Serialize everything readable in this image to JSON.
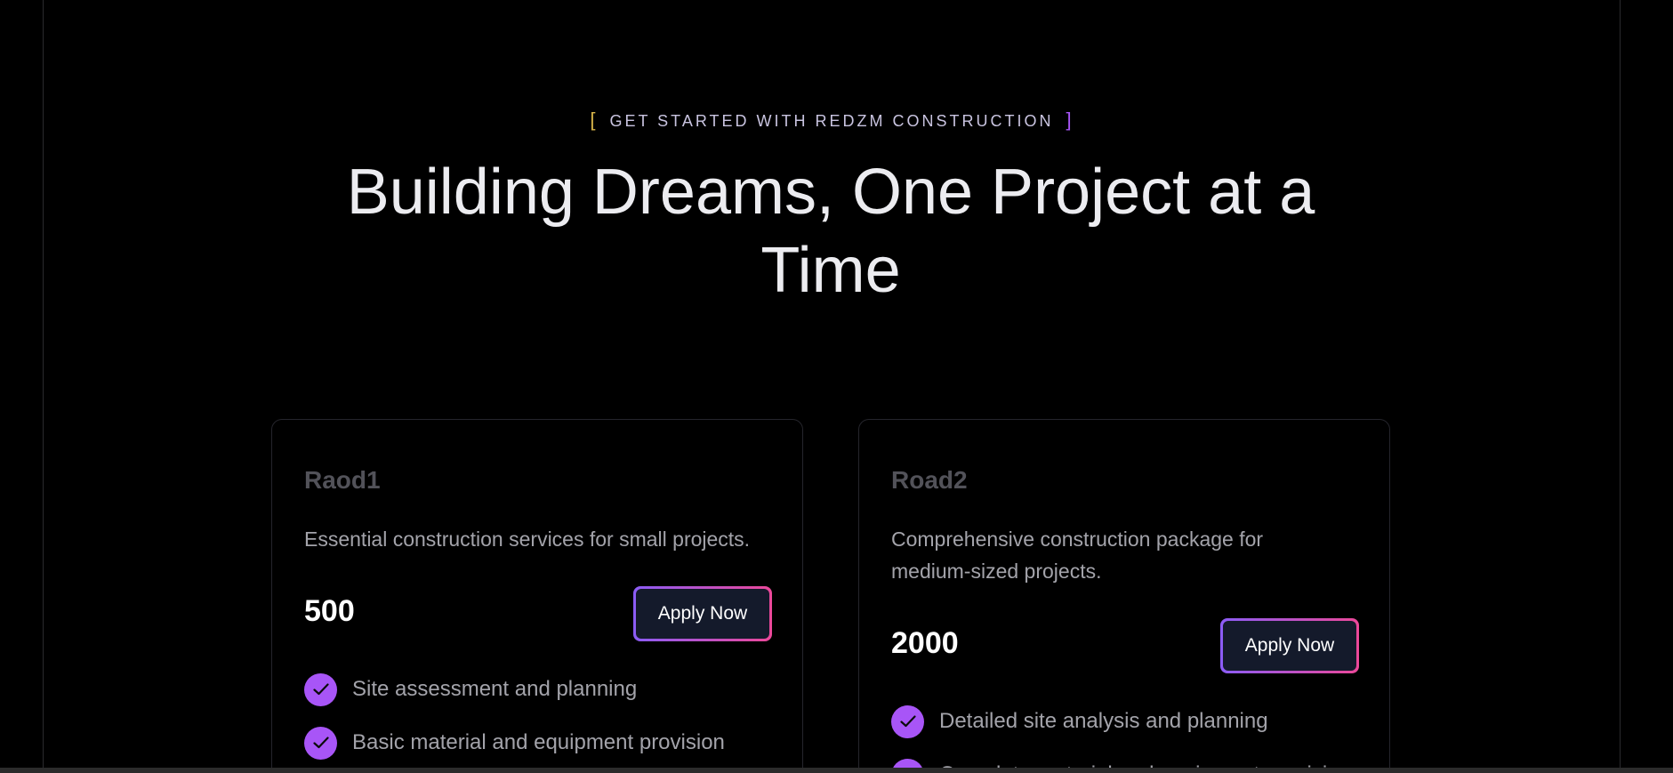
{
  "hero": {
    "eyebrow_text": "GET STARTED WITH REDZM CONSTRUCTION",
    "bracket_left": "[",
    "bracket_right": "]",
    "title": "Building Dreams, One Project at a Time"
  },
  "plans": [
    {
      "name": "Raod1",
      "description": "Essential construction services for small projects.",
      "price": "500",
      "button_label": "Apply Now",
      "features": [
        "Site assessment and planning",
        "Basic material and equipment provision"
      ]
    },
    {
      "name": "Road2",
      "description": "Comprehensive construction package for medium-sized projects.",
      "price": "2000",
      "button_label": "Apply Now",
      "features": [
        "Detailed site analysis and planning",
        "Complete material and equipment provision"
      ]
    }
  ],
  "colors": {
    "background": "#000000",
    "accent_purple": "#a855f7",
    "accent_pink": "#ec4899",
    "bracket_gold": "#d8b449"
  },
  "icons": {
    "feature_icon": "check-icon"
  }
}
